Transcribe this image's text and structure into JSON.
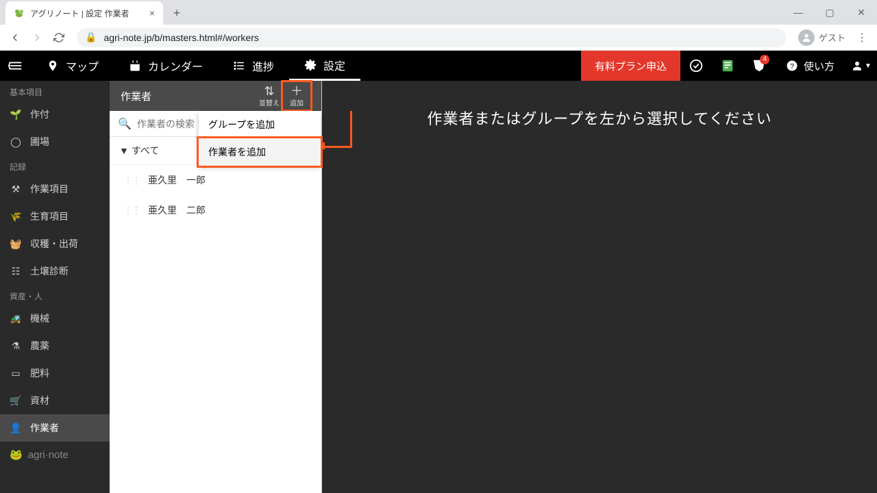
{
  "browser": {
    "tab_title": "アグリノート | 設定 作業者",
    "url": "agri-note.jp/b/masters.html#/workers",
    "guest_label": "ゲスト"
  },
  "topnav": {
    "map": "マップ",
    "calendar": "カレンダー",
    "progress": "進捗",
    "settings": "設定",
    "upgrade": "有料プラン申込",
    "help": "使い方",
    "notif_count": "4"
  },
  "sidebar": {
    "sec_basic": "基本項目",
    "planting": "作付",
    "field": "圃場",
    "sec_record": "記録",
    "work_item": "作業項目",
    "growth_item": "生育項目",
    "harvest": "収穫・出荷",
    "soil": "土壌診断",
    "sec_asset": "資産・人",
    "machine": "機械",
    "pesticide": "農薬",
    "fertilizer": "肥料",
    "material": "資材",
    "worker": "作業者",
    "brand": "agri·note"
  },
  "mid": {
    "title": "作業者",
    "sort": "並替え",
    "add": "追加",
    "search_placeholder": "作業者の検索",
    "all": "▼ すべて",
    "workers": [
      "亜久里　一郎",
      "亜久里　二郎"
    ],
    "dd_group": "グループを追加",
    "dd_worker": "作業者を追加"
  },
  "main": {
    "message": "作業者またはグループを左から選択してください"
  }
}
